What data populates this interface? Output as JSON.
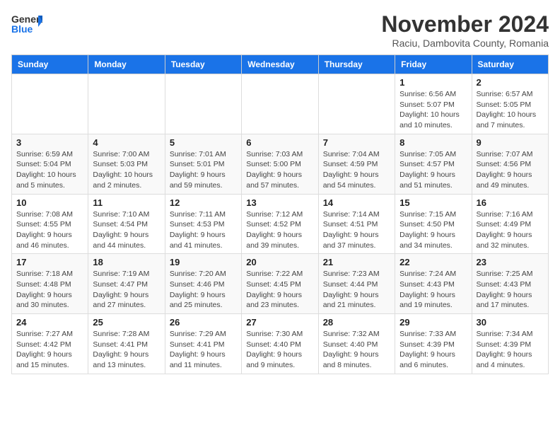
{
  "header": {
    "logo_line1": "General",
    "logo_line2": "Blue",
    "month_title": "November 2024",
    "location": "Raciu, Dambovita County, Romania"
  },
  "weekdays": [
    "Sunday",
    "Monday",
    "Tuesday",
    "Wednesday",
    "Thursday",
    "Friday",
    "Saturday"
  ],
  "weeks": [
    [
      {
        "day": "",
        "info": ""
      },
      {
        "day": "",
        "info": ""
      },
      {
        "day": "",
        "info": ""
      },
      {
        "day": "",
        "info": ""
      },
      {
        "day": "",
        "info": ""
      },
      {
        "day": "1",
        "info": "Sunrise: 6:56 AM\nSunset: 5:07 PM\nDaylight: 10 hours\nand 10 minutes."
      },
      {
        "day": "2",
        "info": "Sunrise: 6:57 AM\nSunset: 5:05 PM\nDaylight: 10 hours\nand 7 minutes."
      }
    ],
    [
      {
        "day": "3",
        "info": "Sunrise: 6:59 AM\nSunset: 5:04 PM\nDaylight: 10 hours\nand 5 minutes."
      },
      {
        "day": "4",
        "info": "Sunrise: 7:00 AM\nSunset: 5:03 PM\nDaylight: 10 hours\nand 2 minutes."
      },
      {
        "day": "5",
        "info": "Sunrise: 7:01 AM\nSunset: 5:01 PM\nDaylight: 9 hours\nand 59 minutes."
      },
      {
        "day": "6",
        "info": "Sunrise: 7:03 AM\nSunset: 5:00 PM\nDaylight: 9 hours\nand 57 minutes."
      },
      {
        "day": "7",
        "info": "Sunrise: 7:04 AM\nSunset: 4:59 PM\nDaylight: 9 hours\nand 54 minutes."
      },
      {
        "day": "8",
        "info": "Sunrise: 7:05 AM\nSunset: 4:57 PM\nDaylight: 9 hours\nand 51 minutes."
      },
      {
        "day": "9",
        "info": "Sunrise: 7:07 AM\nSunset: 4:56 PM\nDaylight: 9 hours\nand 49 minutes."
      }
    ],
    [
      {
        "day": "10",
        "info": "Sunrise: 7:08 AM\nSunset: 4:55 PM\nDaylight: 9 hours\nand 46 minutes."
      },
      {
        "day": "11",
        "info": "Sunrise: 7:10 AM\nSunset: 4:54 PM\nDaylight: 9 hours\nand 44 minutes."
      },
      {
        "day": "12",
        "info": "Sunrise: 7:11 AM\nSunset: 4:53 PM\nDaylight: 9 hours\nand 41 minutes."
      },
      {
        "day": "13",
        "info": "Sunrise: 7:12 AM\nSunset: 4:52 PM\nDaylight: 9 hours\nand 39 minutes."
      },
      {
        "day": "14",
        "info": "Sunrise: 7:14 AM\nSunset: 4:51 PM\nDaylight: 9 hours\nand 37 minutes."
      },
      {
        "day": "15",
        "info": "Sunrise: 7:15 AM\nSunset: 4:50 PM\nDaylight: 9 hours\nand 34 minutes."
      },
      {
        "day": "16",
        "info": "Sunrise: 7:16 AM\nSunset: 4:49 PM\nDaylight: 9 hours\nand 32 minutes."
      }
    ],
    [
      {
        "day": "17",
        "info": "Sunrise: 7:18 AM\nSunset: 4:48 PM\nDaylight: 9 hours\nand 30 minutes."
      },
      {
        "day": "18",
        "info": "Sunrise: 7:19 AM\nSunset: 4:47 PM\nDaylight: 9 hours\nand 27 minutes."
      },
      {
        "day": "19",
        "info": "Sunrise: 7:20 AM\nSunset: 4:46 PM\nDaylight: 9 hours\nand 25 minutes."
      },
      {
        "day": "20",
        "info": "Sunrise: 7:22 AM\nSunset: 4:45 PM\nDaylight: 9 hours\nand 23 minutes."
      },
      {
        "day": "21",
        "info": "Sunrise: 7:23 AM\nSunset: 4:44 PM\nDaylight: 9 hours\nand 21 minutes."
      },
      {
        "day": "22",
        "info": "Sunrise: 7:24 AM\nSunset: 4:43 PM\nDaylight: 9 hours\nand 19 minutes."
      },
      {
        "day": "23",
        "info": "Sunrise: 7:25 AM\nSunset: 4:43 PM\nDaylight: 9 hours\nand 17 minutes."
      }
    ],
    [
      {
        "day": "24",
        "info": "Sunrise: 7:27 AM\nSunset: 4:42 PM\nDaylight: 9 hours\nand 15 minutes."
      },
      {
        "day": "25",
        "info": "Sunrise: 7:28 AM\nSunset: 4:41 PM\nDaylight: 9 hours\nand 13 minutes."
      },
      {
        "day": "26",
        "info": "Sunrise: 7:29 AM\nSunset: 4:41 PM\nDaylight: 9 hours\nand 11 minutes."
      },
      {
        "day": "27",
        "info": "Sunrise: 7:30 AM\nSunset: 4:40 PM\nDaylight: 9 hours\nand 9 minutes."
      },
      {
        "day": "28",
        "info": "Sunrise: 7:32 AM\nSunset: 4:40 PM\nDaylight: 9 hours\nand 8 minutes."
      },
      {
        "day": "29",
        "info": "Sunrise: 7:33 AM\nSunset: 4:39 PM\nDaylight: 9 hours\nand 6 minutes."
      },
      {
        "day": "30",
        "info": "Sunrise: 7:34 AM\nSunset: 4:39 PM\nDaylight: 9 hours\nand 4 minutes."
      }
    ]
  ]
}
